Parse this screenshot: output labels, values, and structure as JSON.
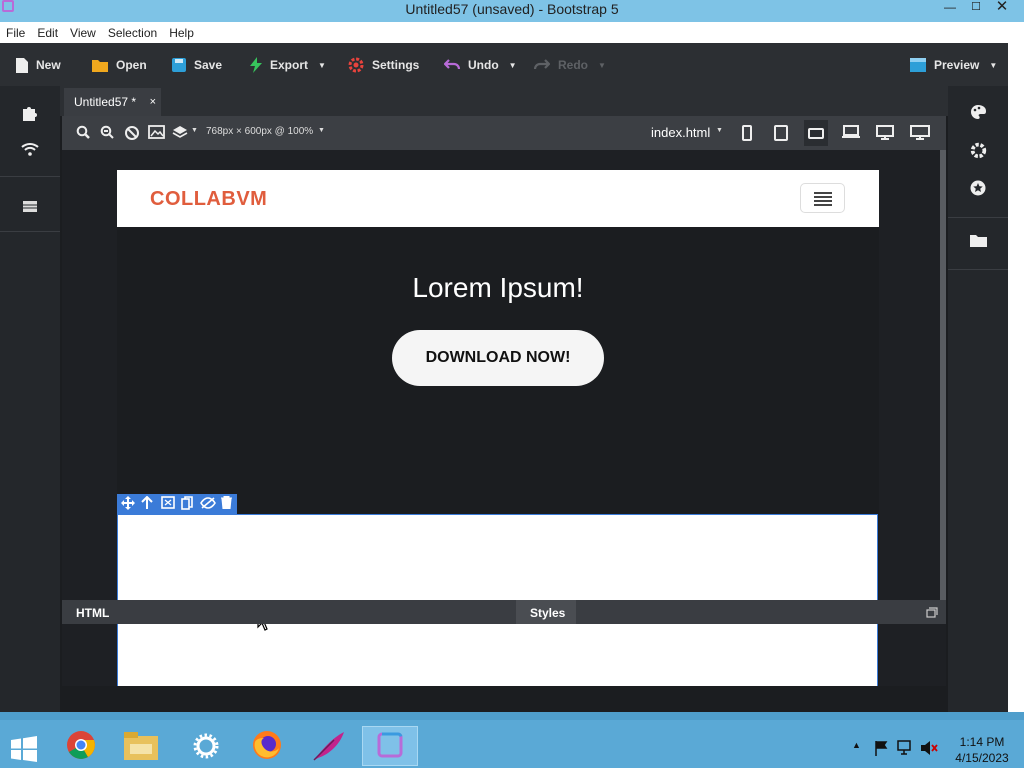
{
  "window": {
    "title": "Untitled57 (unsaved) - Bootstrap 5",
    "min_glyph": "—",
    "max_glyph": "☐",
    "close_glyph": "✕"
  },
  "menu": [
    "File",
    "Edit",
    "View",
    "Selection",
    "Help"
  ],
  "toolbar": {
    "new": "New",
    "open": "Open",
    "save": "Save",
    "export": "Export",
    "settings": "Settings",
    "undo": "Undo",
    "redo": "Redo",
    "preview": "Preview"
  },
  "tab": {
    "label": "Untitled57 *",
    "close": "×"
  },
  "canvas": {
    "size_label": "768px × 600px @ 100%",
    "file": "index.html"
  },
  "site": {
    "brand": "COLLABVM",
    "hero_title": "Lorem Ipsum!",
    "hero_button": "DOWNLOAD NOW!"
  },
  "bottom": {
    "html": "HTML",
    "styles": "Styles"
  },
  "clock": {
    "time": "1:14 PM",
    "date": "4/15/2023"
  },
  "colors": {
    "brand": "#e05d3d",
    "selection": "#3b7bd8",
    "toolbar_bg": "#2c2f33"
  }
}
